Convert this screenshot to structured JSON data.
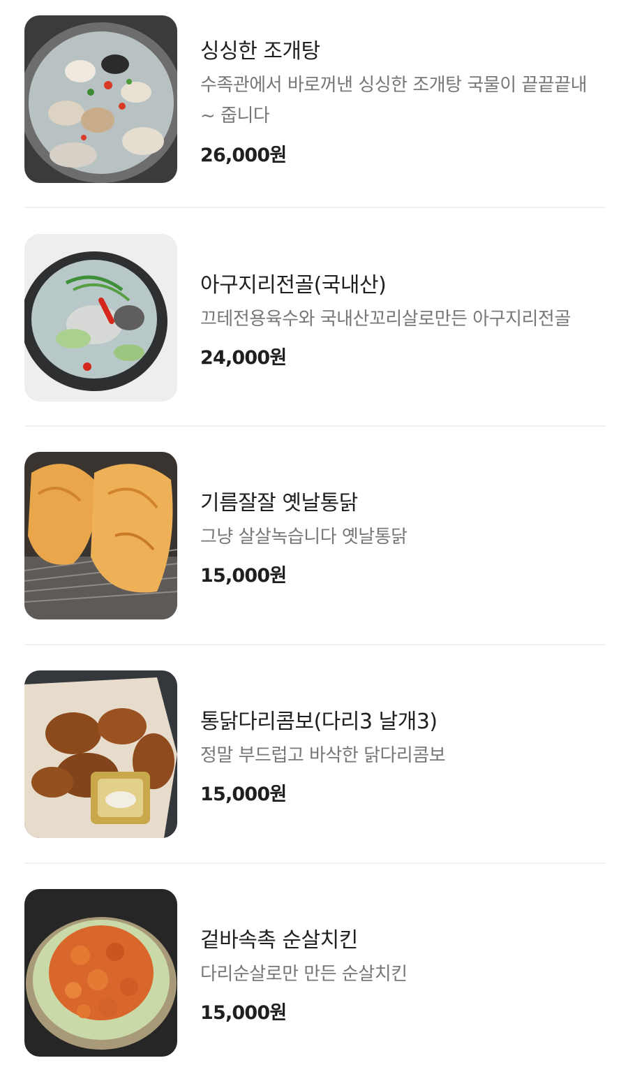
{
  "menu": {
    "currency_suffix": "원",
    "items": [
      {
        "name": "싱싱한 조개탕",
        "description": "수족관에서 바로꺼낸 싱싱한 조개탕 국물이 끝끝끝내~ 줍니다",
        "price": "26,000원",
        "image": "clam-soup-photo"
      },
      {
        "name": "아구지리전골(국내산)",
        "description": "끄테전용육수와 국내산꼬리살로만든 아구지리전골",
        "price": "24,000원",
        "image": "monkfish-hotpot-photo"
      },
      {
        "name": "기름잘잘 옛날통닭",
        "description": "그냥 살살녹습니다 옛날통닭",
        "price": "15,000원",
        "image": "whole-fried-chicken-photo"
      },
      {
        "name": "통닭다리콤보(다리3 날개3)",
        "description": "정말 부드럽고 바삭한 닭다리콤보",
        "price": "15,000원",
        "image": "drumstick-combo-photo"
      },
      {
        "name": "겉바속촉 순살치킨",
        "description": "다리순살로만 만든 순살치킨",
        "price": "15,000원",
        "image": "boneless-chicken-photo"
      }
    ]
  }
}
